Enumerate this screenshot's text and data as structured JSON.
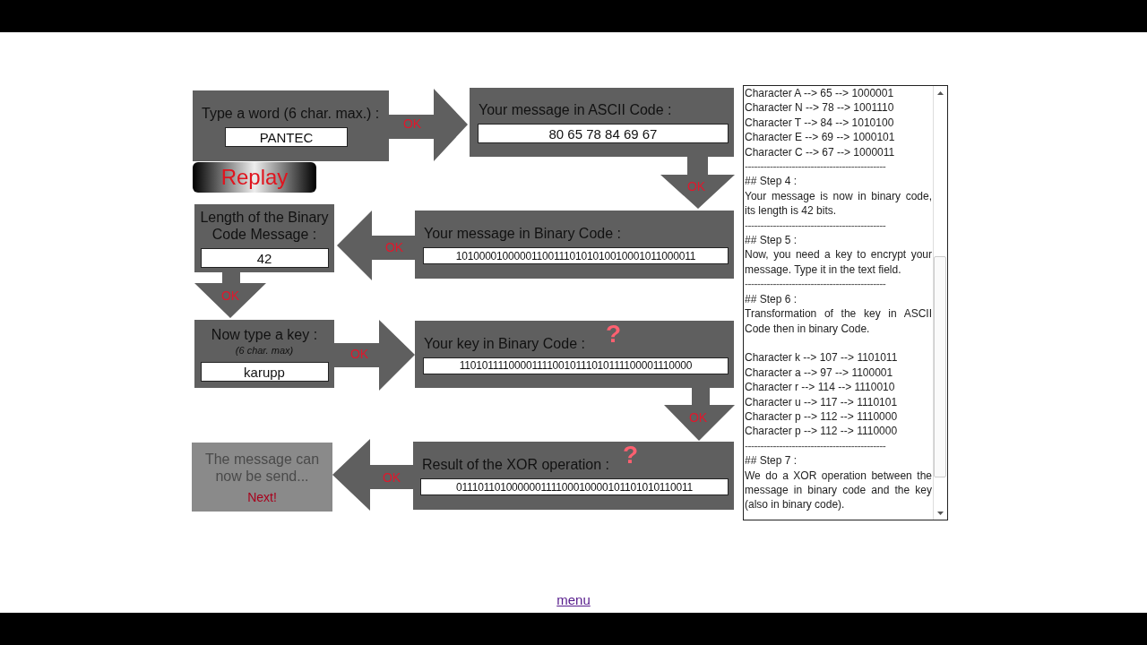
{
  "steps": [
    {
      "kind": "input",
      "label": "Type a word (6 char. max.) :",
      "value": "PANTEC"
    },
    {
      "kind": "output",
      "label": "Your message in ASCII Code :",
      "value": "80 65 78 84 69 67"
    },
    {
      "kind": "output",
      "label": "Length of the Binary Code Message :",
      "value": "42"
    },
    {
      "kind": "output",
      "label": "Your message in Binary Code :",
      "value": "101000010000011001110101010010001011000011"
    },
    {
      "kind": "input",
      "label": "Now type a key :",
      "note": "(6 char. max)",
      "value": "karupp"
    },
    {
      "kind": "output",
      "label": "Your key in Binary Code :",
      "mark": "?",
      "value": "110101111000011110010111010111100001110000"
    },
    {
      "kind": "final",
      "label": "The message can now be send...",
      "link": "Next!"
    },
    {
      "kind": "output",
      "label": "Result of the XOR operation :",
      "mark": "?",
      "value": "011101101000000111100010000101101010110011"
    }
  ],
  "replay_button": "Replay",
  "arrows": [
    {
      "label": "OK"
    },
    {
      "label": "OK"
    },
    {
      "label": "OK"
    },
    {
      "label": "OK"
    },
    {
      "label": "OK"
    },
    {
      "label": "OK"
    },
    {
      "label": "OK"
    }
  ],
  "log": [
    {
      "kind": "line",
      "text": "Character A --> 65 --> 1000001"
    },
    {
      "kind": "line",
      "text": "Character N --> 78 --> 1001110"
    },
    {
      "kind": "line",
      "text": "Character T --> 84 --> 1010100"
    },
    {
      "kind": "line",
      "text": "Character E --> 69 --> 1000101"
    },
    {
      "kind": "line",
      "text": "Character C --> 67 --> 1000011"
    },
    {
      "kind": "separator",
      "text": "---------------------------------------------"
    },
    {
      "kind": "line",
      "text": "## Step 4 :"
    },
    {
      "kind": "paragraph",
      "text": "Your message is now in binary code, its length is 42 bits."
    },
    {
      "kind": "separator",
      "text": "---------------------------------------------"
    },
    {
      "kind": "line",
      "text": "## Step 5 :"
    },
    {
      "kind": "paragraph",
      "text": "Now, you need a key to encrypt your message. Type it in the text field."
    },
    {
      "kind": "separator",
      "text": "---------------------------------------------"
    },
    {
      "kind": "line",
      "text": "## Step 6 :"
    },
    {
      "kind": "paragraph",
      "text": "Transformation of the key in ASCII Code then in binary Code."
    },
    {
      "kind": "blank"
    },
    {
      "kind": "line",
      "text": "Character k --> 107 --> 1101011"
    },
    {
      "kind": "line",
      "text": "Character a --> 97 --> 1100001"
    },
    {
      "kind": "line",
      "text": "Character r --> 114 --> 1110010"
    },
    {
      "kind": "line",
      "text": "Character u --> 117 --> 1110101"
    },
    {
      "kind": "line",
      "text": "Character p --> 112 --> 1110000"
    },
    {
      "kind": "line",
      "text": "Character p --> 112 --> 1110000"
    },
    {
      "kind": "separator",
      "text": "---------------------------------------------"
    },
    {
      "kind": "line",
      "text": "## Step 7 :"
    },
    {
      "kind": "paragraph",
      "text": "We do a XOR operation between the message in binary code and the key (also in binary code)."
    }
  ],
  "menu_link": "menu"
}
